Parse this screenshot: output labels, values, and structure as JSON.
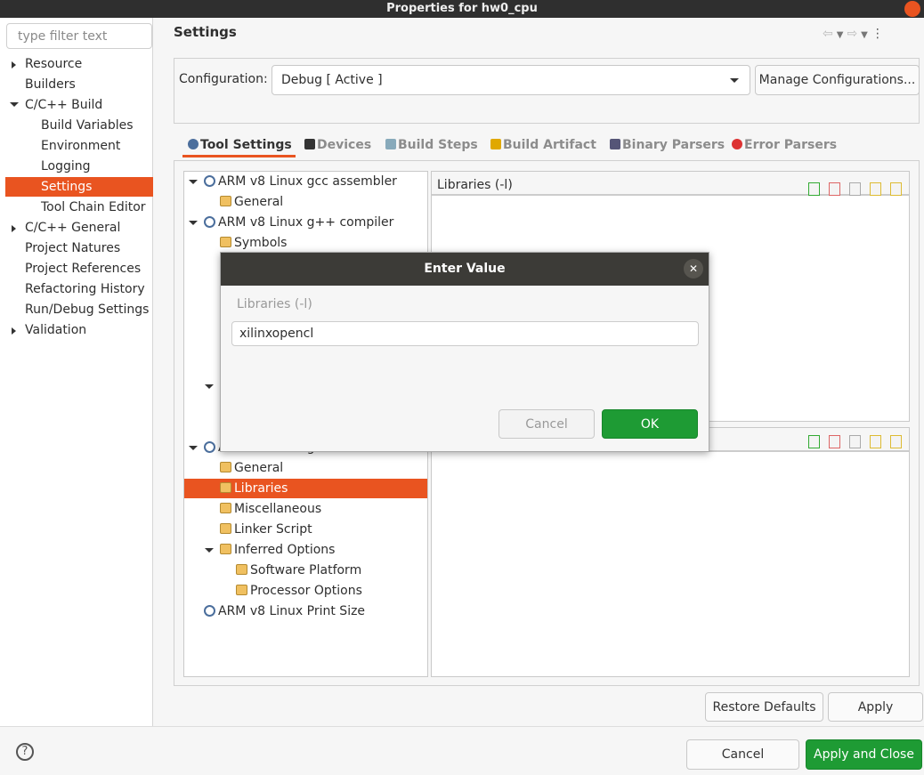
{
  "window": {
    "title": "Properties for hw0_cpu"
  },
  "filter": {
    "placeholder": "type filter text"
  },
  "sidebar": {
    "items": [
      {
        "label": "Resource",
        "level": 0,
        "expander": "collapsed"
      },
      {
        "label": "Builders",
        "level": 0
      },
      {
        "label": "C/C++ Build",
        "level": 0,
        "expander": "expanded"
      },
      {
        "label": "Build Variables",
        "level": 1
      },
      {
        "label": "Environment",
        "level": 1
      },
      {
        "label": "Logging",
        "level": 1
      },
      {
        "label": "Settings",
        "level": 1,
        "selected": true
      },
      {
        "label": "Tool Chain Editor",
        "level": 1
      },
      {
        "label": "C/C++ General",
        "level": 0,
        "expander": "collapsed"
      },
      {
        "label": "Project Natures",
        "level": 0
      },
      {
        "label": "Project References",
        "level": 0
      },
      {
        "label": "Refactoring History",
        "level": 0
      },
      {
        "label": "Run/Debug Settings",
        "level": 0
      },
      {
        "label": "Validation",
        "level": 0,
        "expander": "collapsed"
      }
    ]
  },
  "header": {
    "title": "Settings"
  },
  "config": {
    "label": "Configuration:",
    "value": "Debug  [ Active ]",
    "manage": "Manage Configurations..."
  },
  "tabs": [
    {
      "label": "Tool Settings",
      "active": true,
      "icon": "tool-settings-icon"
    },
    {
      "label": "Devices",
      "icon": "chip-icon"
    },
    {
      "label": "Build Steps",
      "icon": "build-steps-icon"
    },
    {
      "label": "Build Artifact",
      "icon": "trophy-icon"
    },
    {
      "label": "Binary Parsers",
      "icon": "binary-icon"
    },
    {
      "label": "Error Parsers",
      "icon": "error-icon"
    }
  ],
  "tree": [
    {
      "label": "ARM v8 Linux gcc assembler",
      "level": 0,
      "expander": "expanded",
      "icon": "tool"
    },
    {
      "label": "General",
      "level": 1,
      "icon": "folder"
    },
    {
      "label": "ARM v8 Linux g++ compiler",
      "level": 0,
      "expander": "expanded",
      "icon": "tool"
    },
    {
      "label": "Symbols",
      "level": 1,
      "icon": "folder"
    },
    {
      "label": "ARM v8 Linux g++ linker",
      "level": 0,
      "expander": "expanded",
      "icon": "tool"
    },
    {
      "label": "General",
      "level": 1,
      "icon": "folder"
    },
    {
      "label": "Libraries",
      "level": 1,
      "icon": "folder",
      "selected": true
    },
    {
      "label": "Miscellaneous",
      "level": 1,
      "icon": "folder"
    },
    {
      "label": "Linker Script",
      "level": 1,
      "icon": "folder"
    },
    {
      "label": "Inferred Options",
      "level": 1,
      "icon": "folder",
      "expander": "expanded"
    },
    {
      "label": "Software Platform",
      "level": 2,
      "icon": "folder"
    },
    {
      "label": "Processor Options",
      "level": 2,
      "icon": "folder"
    },
    {
      "label": "ARM v8 Linux Print Size",
      "level": 0,
      "icon": "tool"
    }
  ],
  "libraries_pane": {
    "title": "Libraries (-l)"
  },
  "buttons": {
    "restore": "Restore Defaults",
    "apply": "Apply",
    "cancel": "Cancel",
    "apply_close": "Apply and Close"
  },
  "dialog": {
    "title": "Enter Value",
    "label": "Libraries (-l)",
    "value": "xilinxopencl",
    "cancel": "Cancel",
    "ok": "OK"
  },
  "colors": {
    "accent": "#e95420",
    "ok_green": "#1e9b34",
    "titlebar": "#3c3b37"
  }
}
